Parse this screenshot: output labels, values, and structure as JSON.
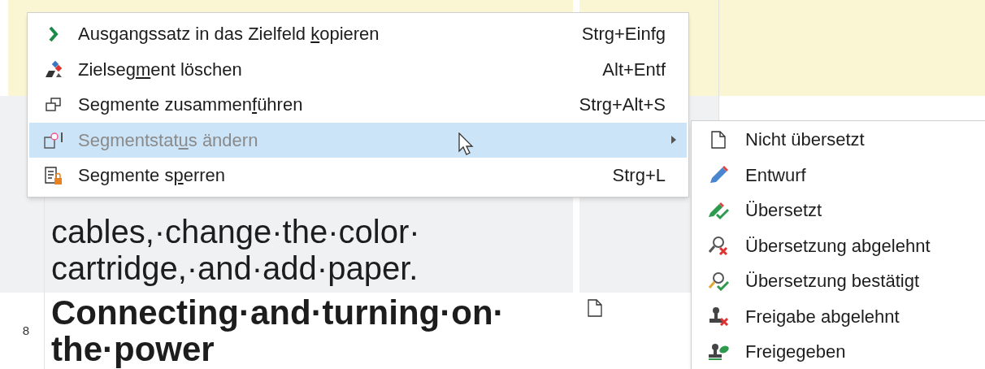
{
  "editor": {
    "rows": [
      {
        "lines": [
          "cables,·change·the·color·",
          "cartridge,·and·add·paper."
        ],
        "kind": "body"
      },
      {
        "number": "8",
        "lines": [
          "Connecting·and·turning·on·",
          "the·power"
        ],
        "kind": "heading",
        "page_icon": true
      }
    ]
  },
  "context_menu": {
    "items": [
      {
        "kind": "copy",
        "label_parts": [
          "Ausgangssatz in das Zielfeld ",
          "k",
          "opieren"
        ],
        "shortcut": "Strg+Einfg",
        "highlighted": false,
        "disabled": false,
        "submenu": false
      },
      {
        "kind": "clear",
        "label_parts": [
          "Zielseg",
          "m",
          "ent löschen"
        ],
        "shortcut": "Alt+Entf",
        "highlighted": false,
        "disabled": false,
        "submenu": false
      },
      {
        "kind": "merge",
        "label_parts": [
          "Segmente zusammen",
          "f",
          "ühren"
        ],
        "shortcut": "Strg+Alt+S",
        "highlighted": false,
        "disabled": false,
        "submenu": false
      },
      {
        "kind": "status",
        "label_parts": [
          "Segmentstat",
          "u",
          "s ändern"
        ],
        "highlighted": true,
        "disabled": true,
        "submenu": true
      },
      {
        "kind": "lock",
        "label_parts": [
          "Segmente s",
          "p",
          "erren"
        ],
        "shortcut": "Strg+L",
        "highlighted": false,
        "disabled": false,
        "submenu": false
      }
    ]
  },
  "status_submenu": {
    "items": [
      {
        "kind": "not_translated",
        "label": "Nicht übersetzt"
      },
      {
        "kind": "draft",
        "label": "Entwurf"
      },
      {
        "kind": "translated",
        "label": "Übersetzt"
      },
      {
        "kind": "translation_rejected",
        "label": "Übersetzung abgelehnt"
      },
      {
        "kind": "translation_approved",
        "label": "Übersetzung bestätigt"
      },
      {
        "kind": "signoff_rejected",
        "label": "Freigabe abgelehnt"
      },
      {
        "kind": "signed_off",
        "label": "Freigegeben"
      }
    ]
  }
}
